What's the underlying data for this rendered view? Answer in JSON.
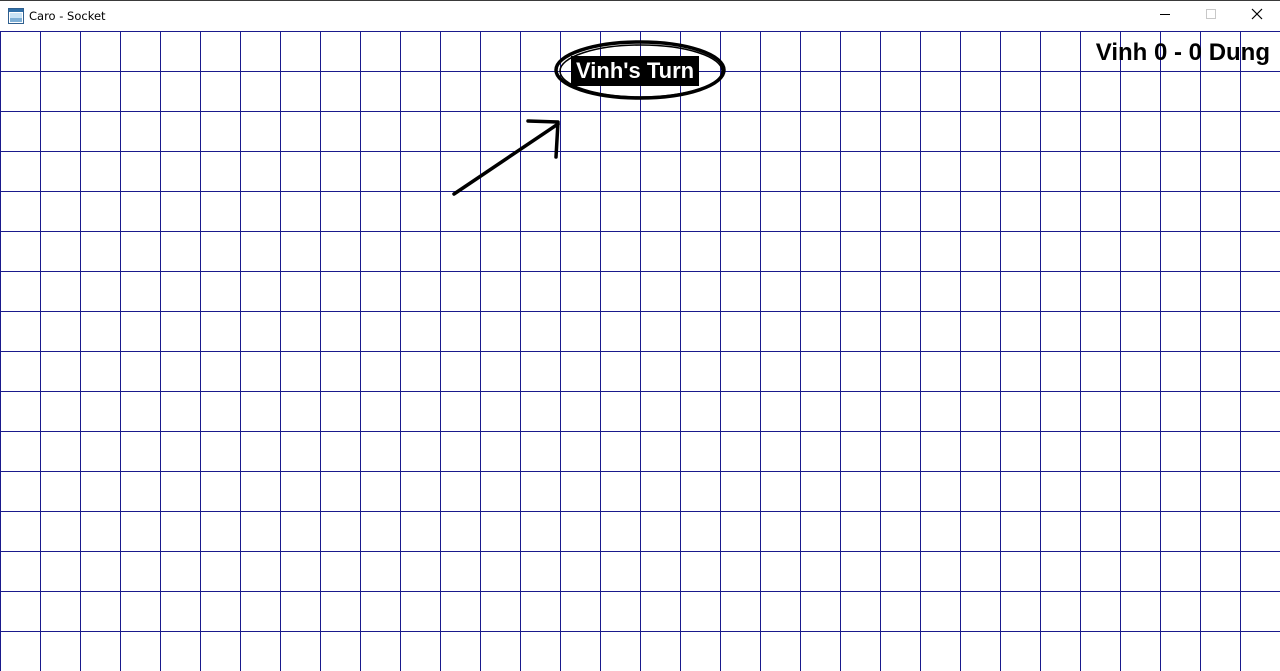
{
  "window": {
    "title": "Caro - Socket",
    "icon": "window-app-icon"
  },
  "controls": {
    "minimize_icon": "minimize-icon",
    "maximize_icon": "maximize-icon",
    "close_icon": "close-icon"
  },
  "game": {
    "turn_text": "Vinh's Turn",
    "player1": "Vinh",
    "player2": "Dung",
    "score1": 0,
    "score2": 0,
    "score_text": "Vinh 0 - 0 Dung",
    "grid_color": "#1a1a8c"
  }
}
